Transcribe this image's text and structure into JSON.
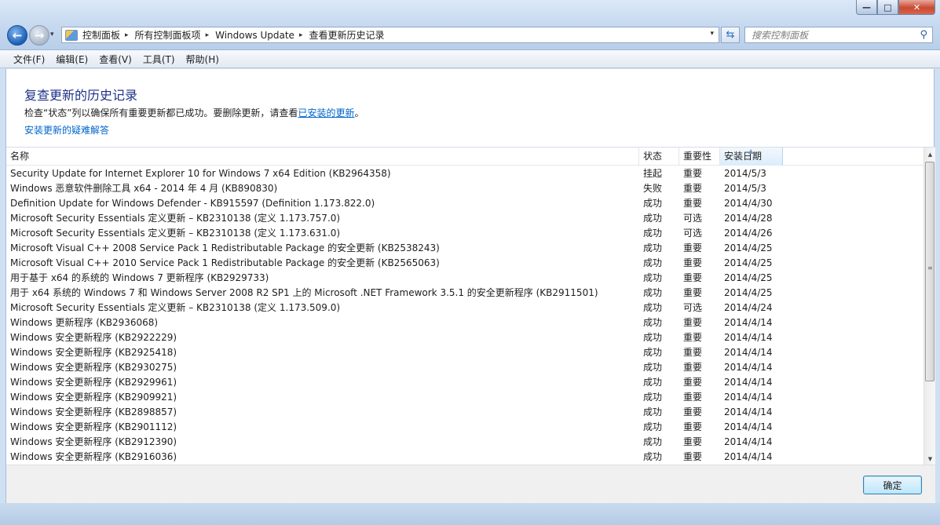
{
  "window": {
    "controls": {
      "minimize": "—",
      "maximize": "□",
      "close": "✕"
    }
  },
  "nav": {
    "back_icon": "←",
    "forward_icon": "→",
    "history_icon": "▾"
  },
  "address": {
    "crumbs": [
      "控制面板",
      "所有控制面板项",
      "Windows Update",
      "查看更新历史记录"
    ],
    "separator": "▸",
    "dropdown_icon": "▾"
  },
  "refresh_icon": "⇆",
  "search": {
    "placeholder": "搜索控制面板",
    "icon": "⚲"
  },
  "menu": [
    "文件(F)",
    "编辑(E)",
    "查看(V)",
    "工具(T)",
    "帮助(H)"
  ],
  "page": {
    "title": "复查更新的历史记录",
    "intro_before": "检查“状态”列以确保所有重要更新都已成功。要删除更新，请查看",
    "intro_link": "已安装的更新",
    "intro_after": "。",
    "trouble_link": "安装更新的疑难解答"
  },
  "list": {
    "columns": {
      "name": "名称",
      "status": "状态",
      "importance": "重要性",
      "date": "安装日期"
    },
    "sort_icon": "▲",
    "rows": [
      {
        "name": "Security Update for Internet Explorer 10 for Windows 7 x64 Edition (KB2964358)",
        "status": "挂起",
        "importance": "重要",
        "date": "2014/5/3"
      },
      {
        "name": "Windows 恶意软件删除工具 x64 - 2014 年 4 月 (KB890830)",
        "status": "失败",
        "importance": "重要",
        "date": "2014/5/3"
      },
      {
        "name": "Definition Update for Windows Defender - KB915597 (Definition 1.173.822.0)",
        "status": "成功",
        "importance": "重要",
        "date": "2014/4/30"
      },
      {
        "name": "Microsoft Security Essentials 定义更新 – KB2310138 (定义 1.173.757.0)",
        "status": "成功",
        "importance": "可选",
        "date": "2014/4/28"
      },
      {
        "name": "Microsoft Security Essentials 定义更新 – KB2310138 (定义 1.173.631.0)",
        "status": "成功",
        "importance": "可选",
        "date": "2014/4/26"
      },
      {
        "name": "Microsoft Visual C++ 2008 Service Pack 1 Redistributable Package 的安全更新 (KB2538243)",
        "status": "成功",
        "importance": "重要",
        "date": "2014/4/25"
      },
      {
        "name": "Microsoft Visual C++ 2010 Service Pack 1 Redistributable Package 的安全更新 (KB2565063)",
        "status": "成功",
        "importance": "重要",
        "date": "2014/4/25"
      },
      {
        "name": "用于基于 x64 的系统的 Windows 7 更新程序 (KB2929733)",
        "status": "成功",
        "importance": "重要",
        "date": "2014/4/25"
      },
      {
        "name": "用于 x64 系统的 Windows 7 和 Windows Server 2008 R2 SP1 上的 Microsoft .NET Framework 3.5.1 的安全更新程序 (KB2911501)",
        "status": "成功",
        "importance": "重要",
        "date": "2014/4/25"
      },
      {
        "name": "Microsoft Security Essentials 定义更新 – KB2310138 (定义 1.173.509.0)",
        "status": "成功",
        "importance": "可选",
        "date": "2014/4/24"
      },
      {
        "name": "Windows 更新程序 (KB2936068)",
        "status": "成功",
        "importance": "重要",
        "date": "2014/4/14"
      },
      {
        "name": "Windows 安全更新程序 (KB2922229)",
        "status": "成功",
        "importance": "重要",
        "date": "2014/4/14"
      },
      {
        "name": "Windows 安全更新程序 (KB2925418)",
        "status": "成功",
        "importance": "重要",
        "date": "2014/4/14"
      },
      {
        "name": "Windows 安全更新程序 (KB2930275)",
        "status": "成功",
        "importance": "重要",
        "date": "2014/4/14"
      },
      {
        "name": "Windows 安全更新程序 (KB2929961)",
        "status": "成功",
        "importance": "重要",
        "date": "2014/4/14"
      },
      {
        "name": "Windows 安全更新程序 (KB2909921)",
        "status": "成功",
        "importance": "重要",
        "date": "2014/4/14"
      },
      {
        "name": "Windows 安全更新程序 (KB2898857)",
        "status": "成功",
        "importance": "重要",
        "date": "2014/4/14"
      },
      {
        "name": "Windows 安全更新程序 (KB2901112)",
        "status": "成功",
        "importance": "重要",
        "date": "2014/4/14"
      },
      {
        "name": "Windows 安全更新程序 (KB2912390)",
        "status": "成功",
        "importance": "重要",
        "date": "2014/4/14"
      },
      {
        "name": "Windows 安全更新程序 (KB2916036)",
        "status": "成功",
        "importance": "重要",
        "date": "2014/4/14"
      }
    ]
  },
  "scrollbar": {
    "up_icon": "▲",
    "down_icon": "▼",
    "grip": "≡"
  },
  "buttons": {
    "ok": "确定"
  },
  "colors": {
    "link": "#0066cc",
    "title": "#1e3287",
    "window_frame": "#cfe0f3"
  }
}
